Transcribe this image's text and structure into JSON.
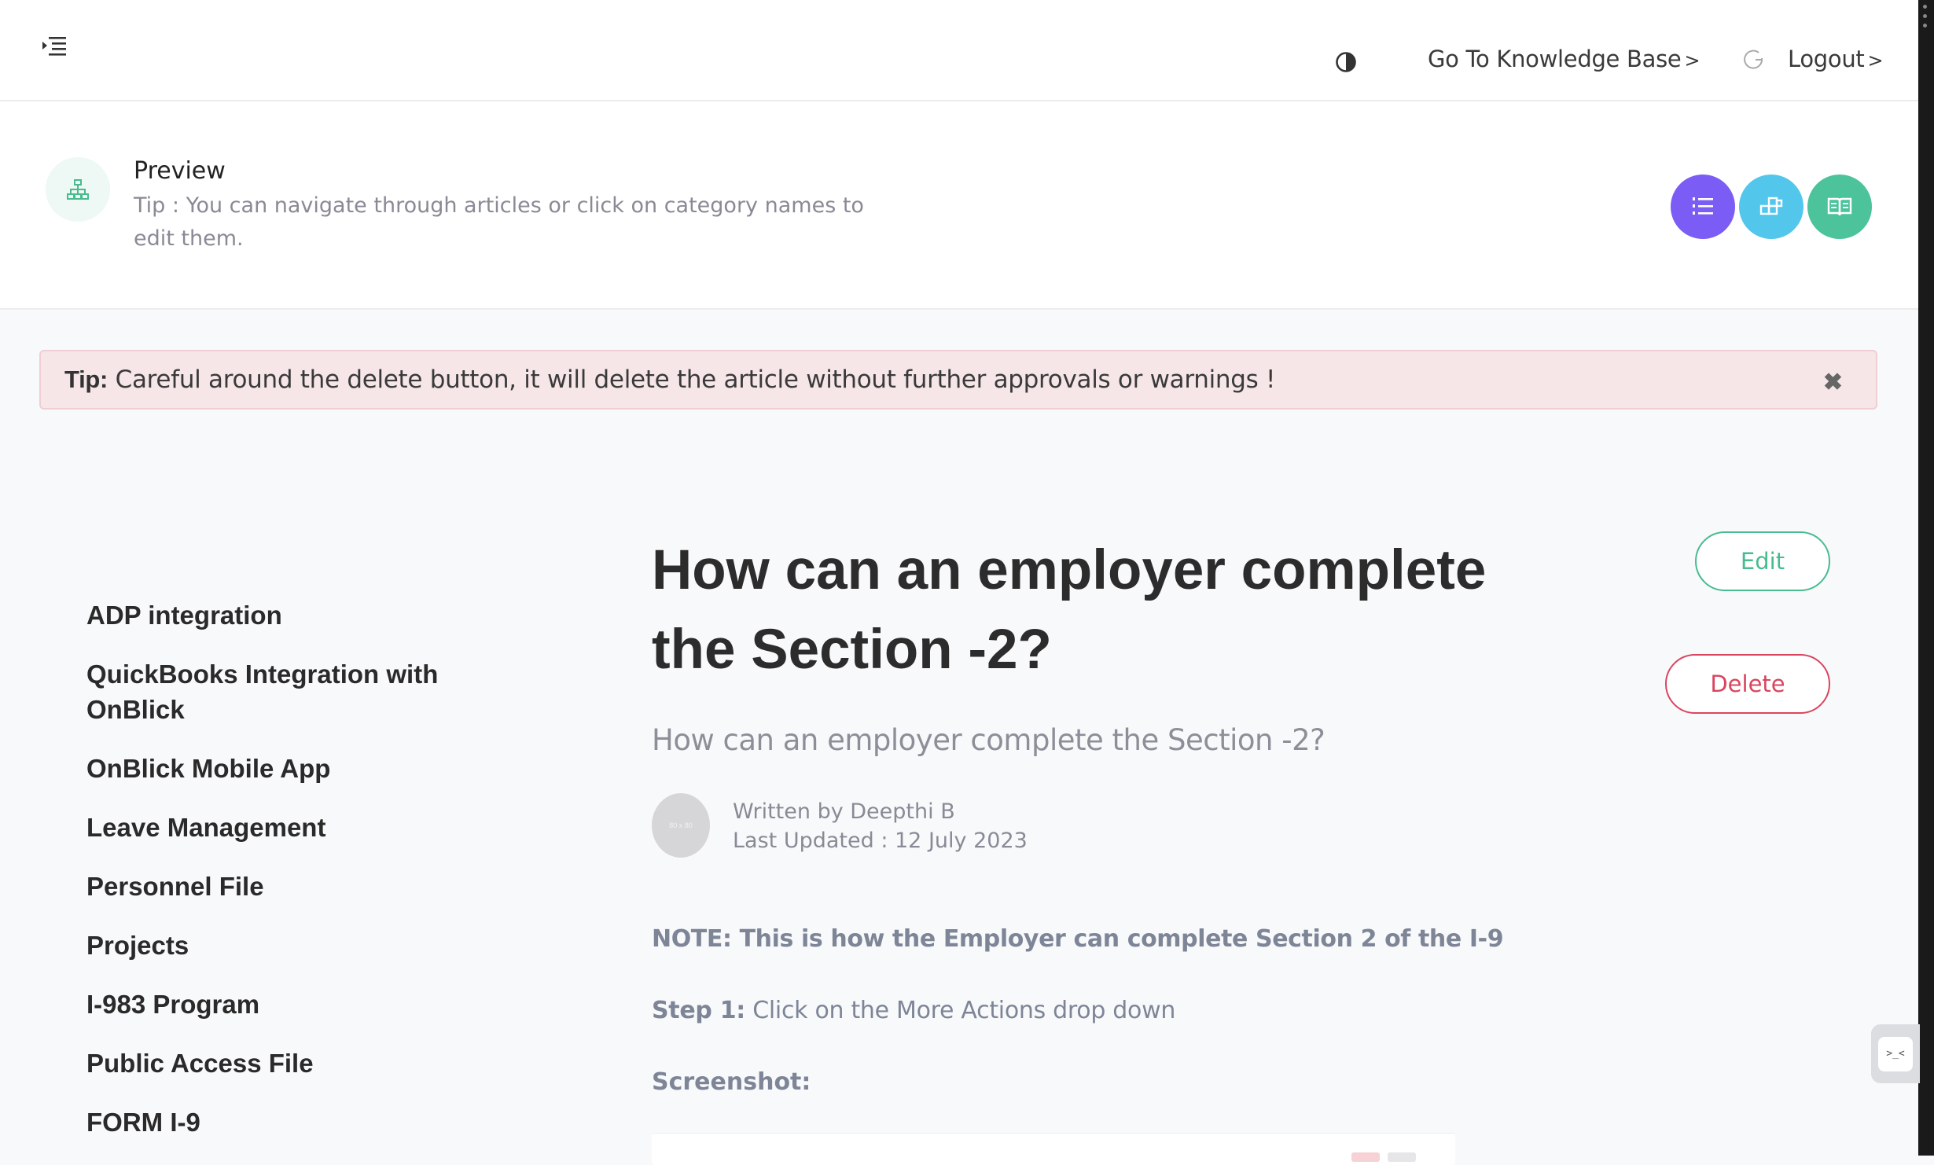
{
  "topbar": {
    "menu_icon": "menu-indent-icon",
    "theme_icon": "contrast-icon",
    "knowledge_base_label": "Go To Knowledge Base",
    "logout_label": "Logout",
    "chevron": ">"
  },
  "preview": {
    "icon": "sitemap-icon",
    "title": "Preview",
    "tip": "Tip : You can navigate through articles or click on category names to edit them.",
    "buttons": [
      {
        "icon": "list-icon",
        "color": "#7b5cf5"
      },
      {
        "icon": "grid-blocks-icon",
        "color": "#53c6ec"
      },
      {
        "icon": "open-book-icon",
        "color": "#4cc39b"
      }
    ]
  },
  "alert": {
    "label": "Tip:",
    "message": "Careful around the delete button, it will delete the article without further approvals or warnings !",
    "close": "✖"
  },
  "sidebar": {
    "items": [
      "ADP integration",
      "QuickBooks Integration with OnBlick",
      "OnBlick Mobile App",
      "Leave Management",
      "Personnel File",
      "Projects",
      "I-983 Program",
      "Public Access File",
      "FORM I-9"
    ]
  },
  "article": {
    "title": "How can an employer complete the Section -2?",
    "subtitle": "How can an employer complete the Section -2?",
    "avatar_text": "80 x 80",
    "written_by": "Written by Deepthi B",
    "last_updated": "Last Updated : 12 July 2023",
    "note": "NOTE: This is how the Employer can complete Section 2 of the I-9",
    "step_label": "Step 1:",
    "step_text": "Click on the More Actions drop down",
    "screenshot_label": "Screenshot:"
  },
  "actions": {
    "edit_label": "Edit",
    "delete_label": "Delete"
  },
  "colors": {
    "green": "#48bb8f",
    "red": "#d9455f",
    "purple": "#7b5cf5",
    "cyan": "#53c6ec"
  },
  "widget": {
    "glyph": ">_<"
  }
}
